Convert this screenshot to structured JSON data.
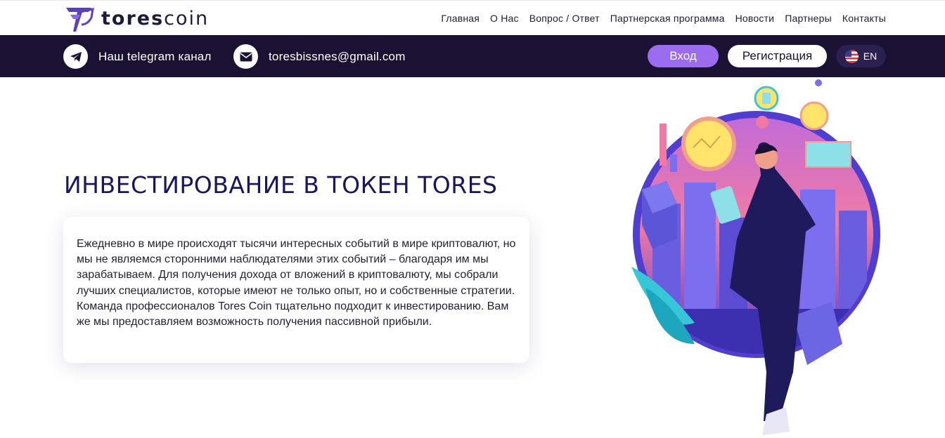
{
  "brand": {
    "name_bold": "tores",
    "name_light": "coin"
  },
  "nav": {
    "items": [
      "Главная",
      "О Нас",
      "Вопрос / Ответ",
      "Партнерская программа",
      "Новости",
      "Партнеры",
      "Контакты"
    ]
  },
  "topbar": {
    "telegram_label": "Наш telegram канал",
    "email": "toresbissnes@gmail.com",
    "login_label": "Вход",
    "register_label": "Регистрация",
    "language": "EN"
  },
  "hero": {
    "title": "ИНВЕСТИРОВАНИЕ В ТОКЕН TORES",
    "description": "Ежедневно в мире происходят тысячи интересных событий в мире криптовалют, но мы не являемся сторонними наблюдателями этих событий – благодаря им мы зарабатываем. Для получения дохода от вложений в криптовалюту, мы собрали лучших специалистов, которые имеют не только опыт, но и собственные стратегии. Команда профессионалов Tores Coin тщательно подходит к инвестированию. Вам же мы предоставляем возможность получения пассивной прибыли."
  },
  "colors": {
    "accent": "#9b6bf0",
    "dark_bar": "#1a1133",
    "title": "#1b1560"
  },
  "icons": [
    "toxcoin-logo-icon",
    "telegram-icon",
    "mail-icon",
    "us-flag-icon"
  ]
}
